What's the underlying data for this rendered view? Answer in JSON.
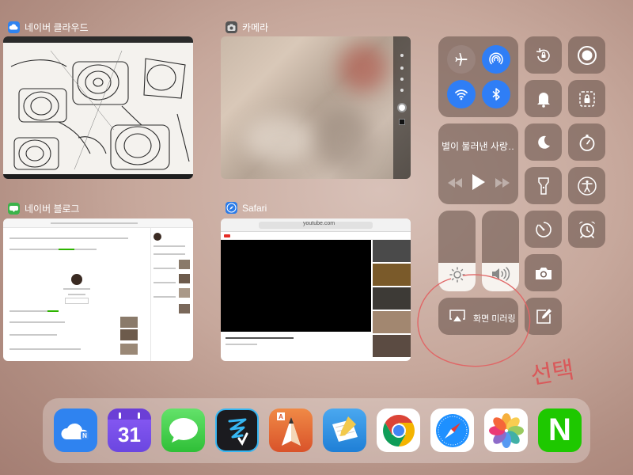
{
  "app_cards": [
    {
      "id": "naver-cloud",
      "label": "네이버 클라우드",
      "icon": "cloud-icon",
      "color": "#2f83f0"
    },
    {
      "id": "camera",
      "label": "카메라",
      "icon": "camera-icon",
      "color": "#555555"
    },
    {
      "id": "naver-blog",
      "label": "네이버 블로그",
      "icon": "blog-icon",
      "color": "#3bb34a"
    },
    {
      "id": "safari",
      "label": "Safari",
      "icon": "compass-icon",
      "color": "#2b7be8"
    }
  ],
  "safari_thumb": {
    "url": "youtube.com"
  },
  "control_center": {
    "connectivity": {
      "airplane": {
        "icon": "airplane-icon",
        "active": false
      },
      "airdrop": {
        "icon": "airdrop-icon",
        "active": true
      },
      "wifi": {
        "icon": "wifi-icon",
        "active": true
      },
      "bluetooth": {
        "icon": "bluetooth-icon",
        "active": true
      }
    },
    "music": {
      "title": "별이 불러낸 사랑…"
    },
    "brightness_level": 0.35,
    "volume_level": 0.35,
    "screen_mirroring": {
      "label": "화면 미러링"
    },
    "active_color": "#2f7ef6"
  },
  "dock": {
    "apps": [
      {
        "name": "naver-cloud",
        "icon": "cloud-icon"
      },
      {
        "name": "calendar",
        "icon": "calendar-icon",
        "day": "31"
      },
      {
        "name": "messages",
        "icon": "messages-icon"
      },
      {
        "name": "zoom-notes",
        "icon": "pen-icon"
      },
      {
        "name": "sketchbook",
        "icon": "pencil-icon"
      },
      {
        "name": "notes",
        "icon": "notes-icon"
      },
      {
        "name": "chrome",
        "icon": "chrome-icon"
      },
      {
        "name": "safari",
        "icon": "safari-icon"
      },
      {
        "name": "photos",
        "icon": "photos-icon"
      },
      {
        "name": "naver",
        "icon": "naver-icon",
        "letter": "N"
      }
    ]
  },
  "annotation": {
    "text": "선택",
    "color": "#d9595a"
  }
}
